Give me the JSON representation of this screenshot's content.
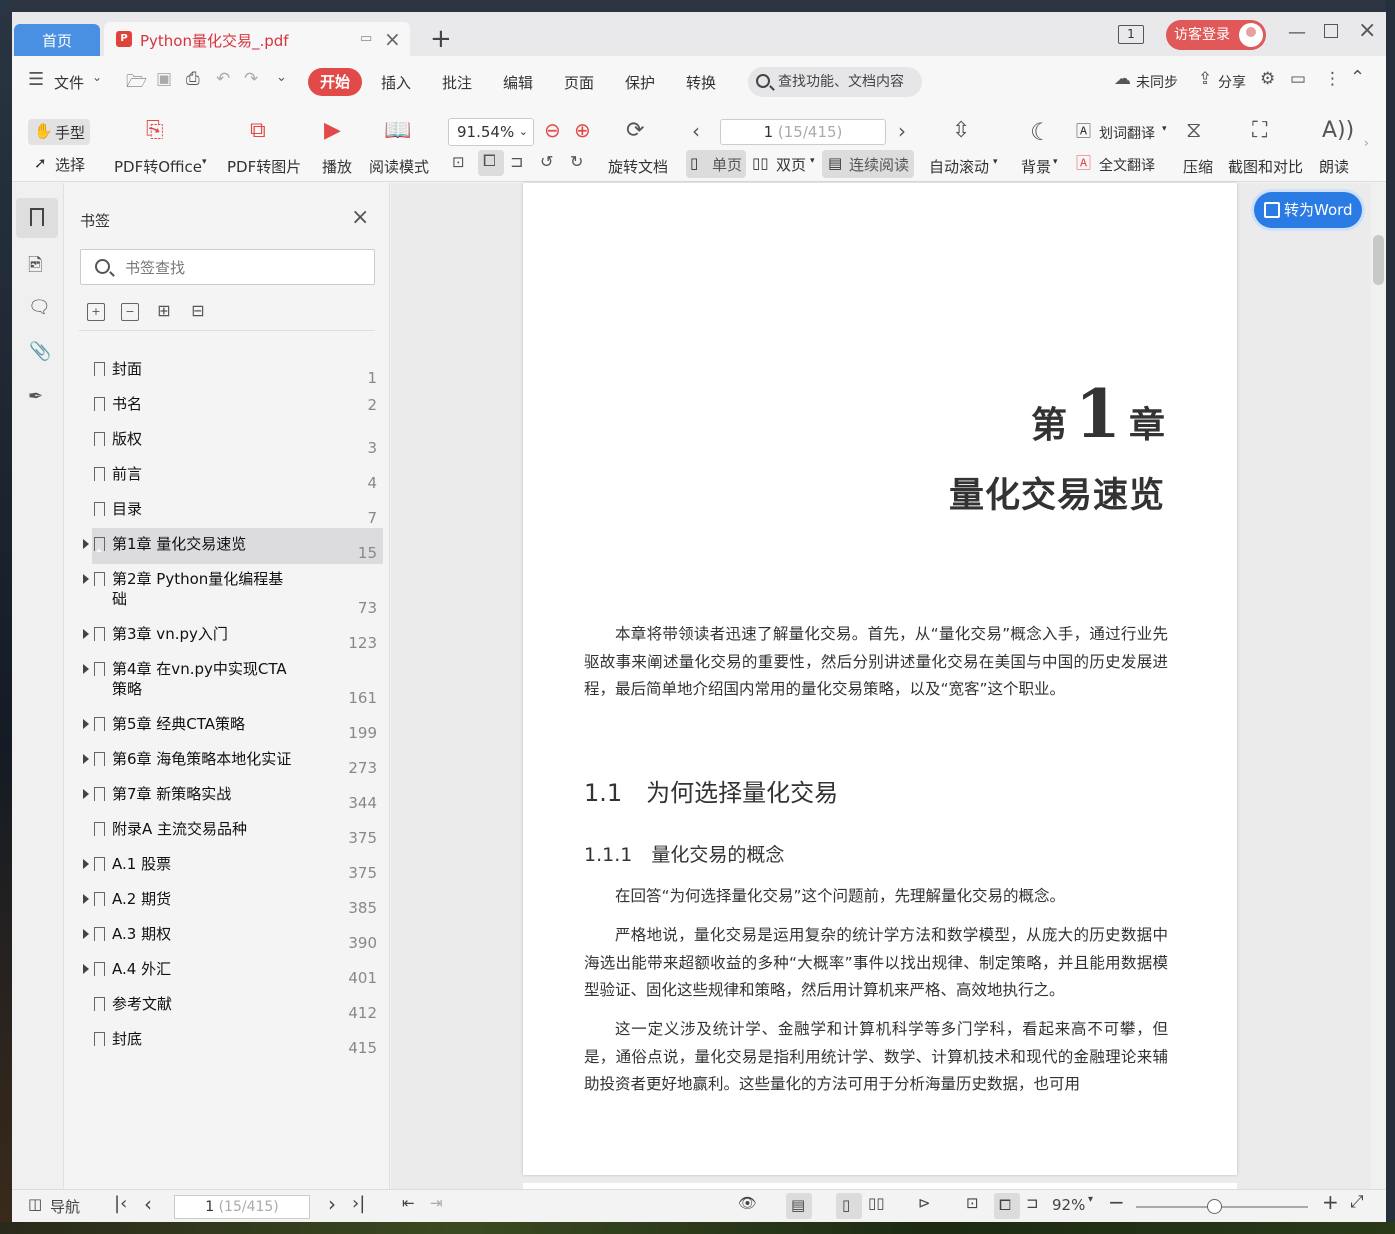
{
  "titlebar": {
    "home_tab": "首页",
    "doc_tab": "Python量化交易_.pdf",
    "pdf_badge": "P",
    "login": "访客登录",
    "page_indicator": "1"
  },
  "menubar": {
    "file": "文件",
    "tabs": [
      "开始",
      "插入",
      "批注",
      "编辑",
      "页面",
      "保护",
      "转换"
    ],
    "search_placeholder": "查找功能、文档内容",
    "sync": "未同步",
    "share": "分享"
  },
  "ribbon": {
    "hand": "手型",
    "select": "选择",
    "pdf_to_office": "PDF转Office",
    "pdf_to_image": "PDF转图片",
    "play": "播放",
    "read_mode": "阅读模式",
    "zoom": "91.54%",
    "rotate": "旋转文档",
    "page_current": "1",
    "page_total": " (15/415)",
    "single": "单页",
    "double": "双页",
    "continuous": "连续阅读",
    "auto_scroll": "自动滚动",
    "background": "背景",
    "word_translate": "划词翻译",
    "full_translate": "全文翻译",
    "compress": "压缩",
    "screenshot_compare": "截图和对比",
    "read_aloud": "朗读"
  },
  "bookmarks": {
    "title": "书签",
    "search_placeholder": "书签查找",
    "items": [
      {
        "label": "封面",
        "page": "1",
        "expandable": false
      },
      {
        "label": "书名",
        "page": "2",
        "expandable": false
      },
      {
        "label": "版权",
        "page": "3",
        "expandable": false
      },
      {
        "label": "前言",
        "page": "4",
        "expandable": false
      },
      {
        "label": "目录",
        "page": "7",
        "expandable": false
      },
      {
        "label": "第1章 量化交易速览",
        "page": "15",
        "expandable": true,
        "selected": true
      },
      {
        "label": "第2章 Python量化编程基础",
        "page": "73",
        "expandable": true
      },
      {
        "label": "第3章 vn.py入门",
        "page": "123",
        "expandable": true
      },
      {
        "label": "第4章 在vn.py中实现CTA策略",
        "page": "161",
        "expandable": true
      },
      {
        "label": "第5章 经典CTA策略",
        "page": "199",
        "expandable": true
      },
      {
        "label": "第6章 海龟策略本地化实证",
        "page": "273",
        "expandable": true
      },
      {
        "label": "第7章 新策略实战",
        "page": "344",
        "expandable": true
      },
      {
        "label": "附录A 主流交易品种",
        "page": "375",
        "expandable": false
      },
      {
        "label": "A.1 股票",
        "page": "375",
        "expandable": true
      },
      {
        "label": "A.2 期货",
        "page": "385",
        "expandable": true
      },
      {
        "label": "A.3 期权",
        "page": "390",
        "expandable": true
      },
      {
        "label": "A.4 外汇",
        "page": "401",
        "expandable": true
      },
      {
        "label": "参考文献",
        "page": "412",
        "expandable": false
      },
      {
        "label": "封底",
        "page": "415",
        "expandable": false
      }
    ]
  },
  "document": {
    "chapter_prefix": "第",
    "chapter_number": "1",
    "chapter_suffix": "章",
    "chapter_title": "量化交易速览",
    "intro": "本章将带领读者迅速了解量化交易。首先，从“量化交易”概念入手，通过行业先驱故事来阐述量化交易的重要性，然后分别讲述量化交易在美国与中国的历史发展进程，最后简单地介绍国内常用的量化交易策略，以及“宽客”这个职业。",
    "section_heading": "1.1　为何选择量化交易",
    "subsection_heading": "1.1.1　量化交易的概念",
    "p1": "在回答“为何选择量化交易”这个问题前，先理解量化交易的概念。",
    "p2": "严格地说，量化交易是运用复杂的统计学方法和数学模型，从庞大的历史数据中海选出能带来超额收益的多种“大概率”事件以找出规律、制定策略，并且能用数据模型验证、固化这些规律和策略，然后用计算机来严格、高效地执行之。",
    "p3": "这一定义涉及统计学、金融学和计算机科学等多门学科，看起来高不可攀，但是，通俗点说，量化交易是指利用统计学、数学、计算机技术和现代的金融理论来辅助投资者更好地赢利。这些量化的方法可用于分析海量历史数据，也可用",
    "to_word": "转为Word"
  },
  "statusbar": {
    "nav": "导航",
    "page_current": "1",
    "page_total": " (15/415)",
    "zoom": "92%"
  },
  "colors": {
    "accent_red": "#e24a4a",
    "home_tab_blue": "#4a90e2",
    "convert_blue": "#2b7be5"
  }
}
